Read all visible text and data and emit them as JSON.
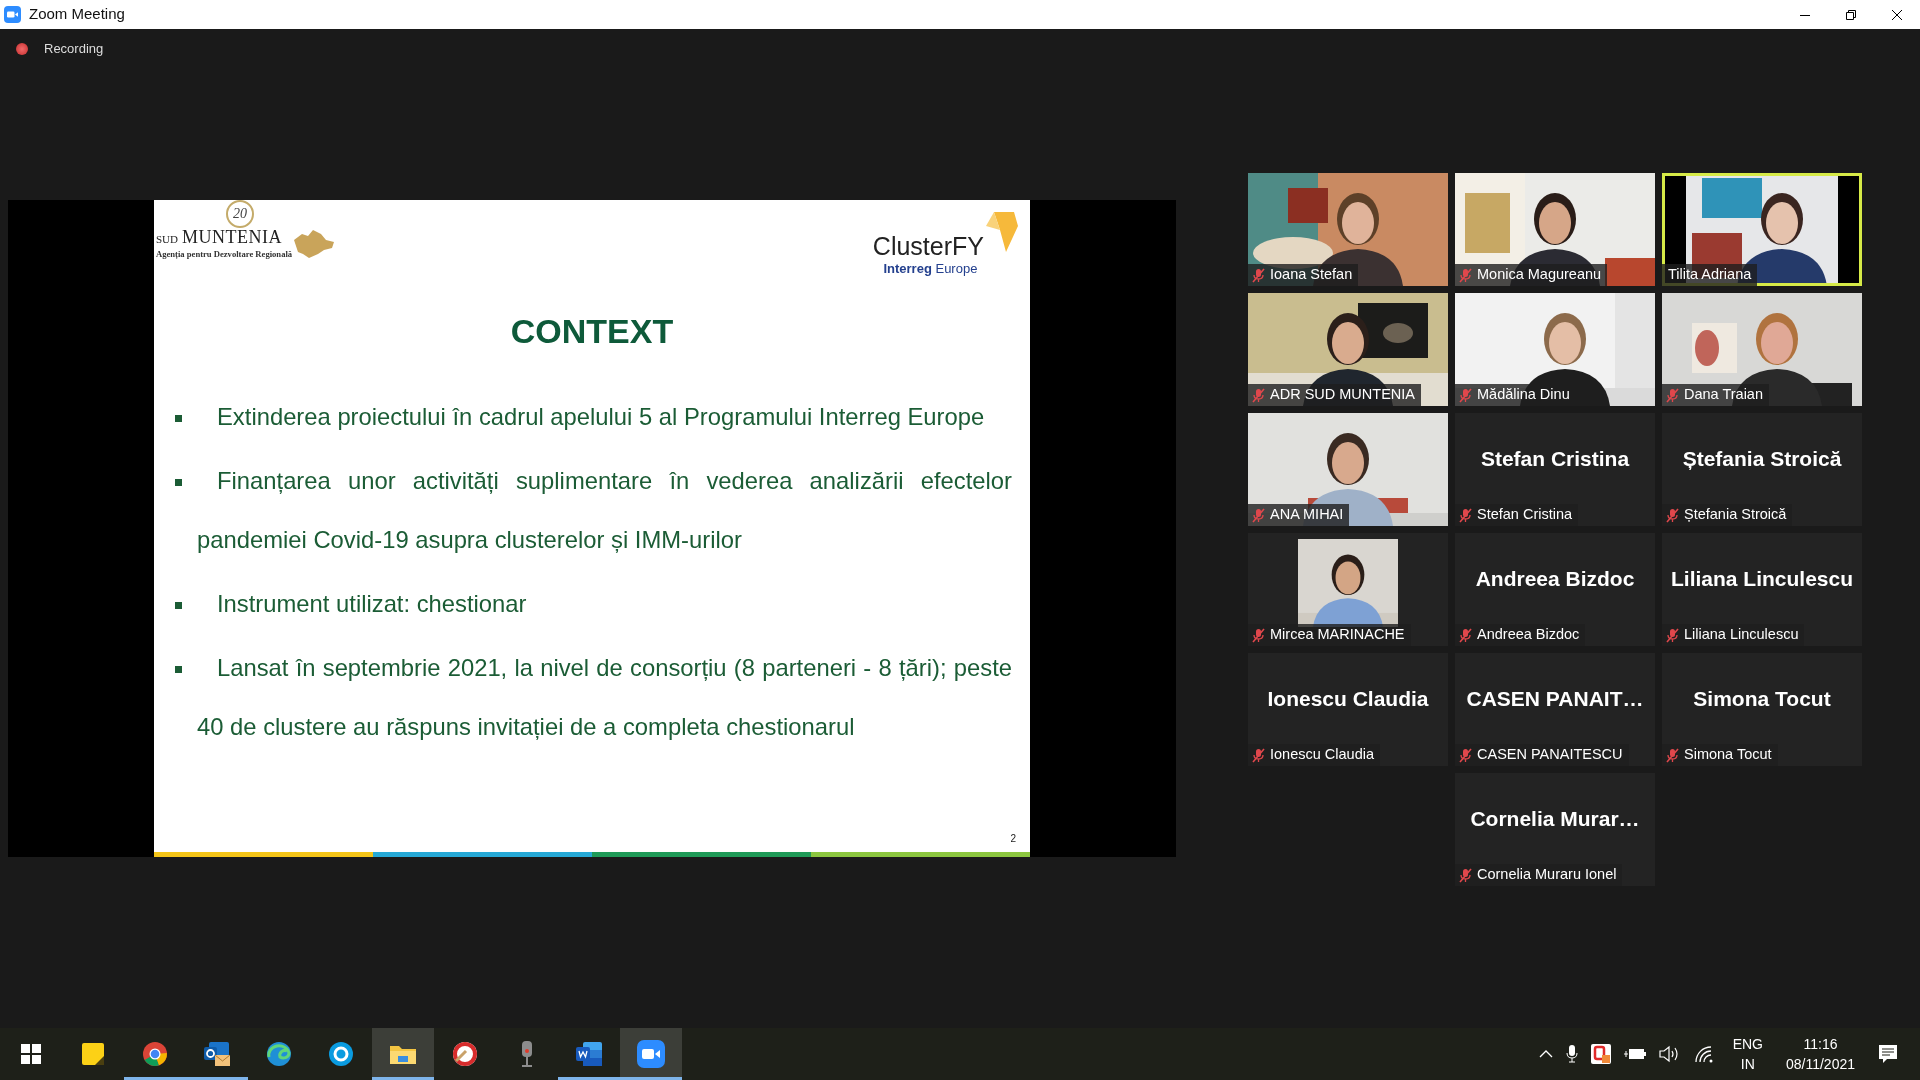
{
  "window": {
    "title": "Zoom Meeting"
  },
  "recording": {
    "label": "Recording",
    "on": true
  },
  "slide": {
    "badge": "20",
    "logo_small": "SUD",
    "logo_name": "MUNTENIA",
    "logo_caption": "Agenția pentru Dezvoltare Regională",
    "brand": "ClusterFY",
    "brand_sub": "**Interreg** Europe",
    "title": "CONTEXT",
    "bullets": [
      "Extinderea proiectului în cadrul apelului 5 al Programului Interreg Europe",
      "Finanțarea unor activități suplimentare în vederea analizării efectelor pandemiei Covid-19 asupra clusterelor și IMM-urilor",
      "Instrument utilizat: chestionar",
      "Lansat în septembrie 2021, la nivel de consorțiu (8 parteneri - 8 țări); peste 40 de clustere au răspuns invitației de a completa chestionarul"
    ],
    "page": "2"
  },
  "participants": [
    {
      "name": "Ioana Stefan",
      "kind": "video",
      "muted": true,
      "speaking": false
    },
    {
      "name": "Monica Magureanu",
      "kind": "video",
      "muted": true,
      "speaking": false
    },
    {
      "name": "Tilita Adriana",
      "kind": "video",
      "muted": false,
      "speaking": true
    },
    {
      "name": "ADR SUD MUNTENIA",
      "kind": "video",
      "muted": true,
      "speaking": false
    },
    {
      "name": "Mădălina Dinu",
      "kind": "video",
      "muted": true,
      "speaking": false
    },
    {
      "name": "Dana Traian",
      "kind": "video",
      "muted": true,
      "speaking": false
    },
    {
      "name": "ANA MIHAI",
      "kind": "video",
      "muted": true,
      "speaking": false
    },
    {
      "name": "Stefan Cristina",
      "kind": "avatar",
      "display": "Stefan Cristina",
      "muted": true,
      "speaking": false
    },
    {
      "name": "Ștefania Stroică",
      "kind": "avatar",
      "display": "Ștefania Stroică",
      "muted": true,
      "speaking": false
    },
    {
      "name": "Mircea MARINACHE",
      "muted": true,
      "speaking": false
    },
    {
      "name": "Andreea Bizdoc",
      "kind": "avatar",
      "display": "Andreea Bizdoc",
      "muted": true,
      "speaking": false
    },
    {
      "name": "Liliana Linculescu",
      "kind": "avatar",
      "display": "Liliana Linculescu",
      "muted": true,
      "speaking": false
    },
    {
      "name": "Ionescu Claudia",
      "kind": "avatar",
      "display": "Ionescu Claudia",
      "muted": true,
      "speaking": false
    },
    {
      "name": "CASEN PANAITESCU",
      "kind": "avatar",
      "display": "CASEN PANAIT…",
      "muted": true,
      "speaking": false
    },
    {
      "name": "Simona Tocut",
      "kind": "avatar",
      "display": "Simona Tocut",
      "muted": true,
      "speaking": false
    },
    {
      "name": "Cornelia Muraru Ionel",
      "kind": "avatar",
      "display": "Cornelia Murar…",
      "muted": true,
      "speaking": false
    }
  ],
  "taskbar": {
    "apps": [
      {
        "kind": "start",
        "running": false,
        "focused": false
      },
      {
        "kind": "notes",
        "running": false,
        "focused": false
      },
      {
        "kind": "browser",
        "running": true,
        "focused": false
      },
      {
        "kind": "mail",
        "running": true,
        "focused": false
      },
      {
        "kind": "edge",
        "running": false,
        "focused": false
      },
      {
        "kind": "chat",
        "running": false,
        "focused": false
      },
      {
        "kind": "folder",
        "running": true,
        "focused": true
      },
      {
        "kind": "cleaner",
        "running": false,
        "focused": false
      },
      {
        "kind": "recorder",
        "running": false,
        "focused": false
      },
      {
        "kind": "word",
        "running": true,
        "focused": false
      },
      {
        "kind": "zoom",
        "running": true,
        "focused": true
      }
    ],
    "tray": {
      "language": "ENG",
      "layout": "IN",
      "time": "11:16",
      "date": "08/11/2021"
    }
  }
}
